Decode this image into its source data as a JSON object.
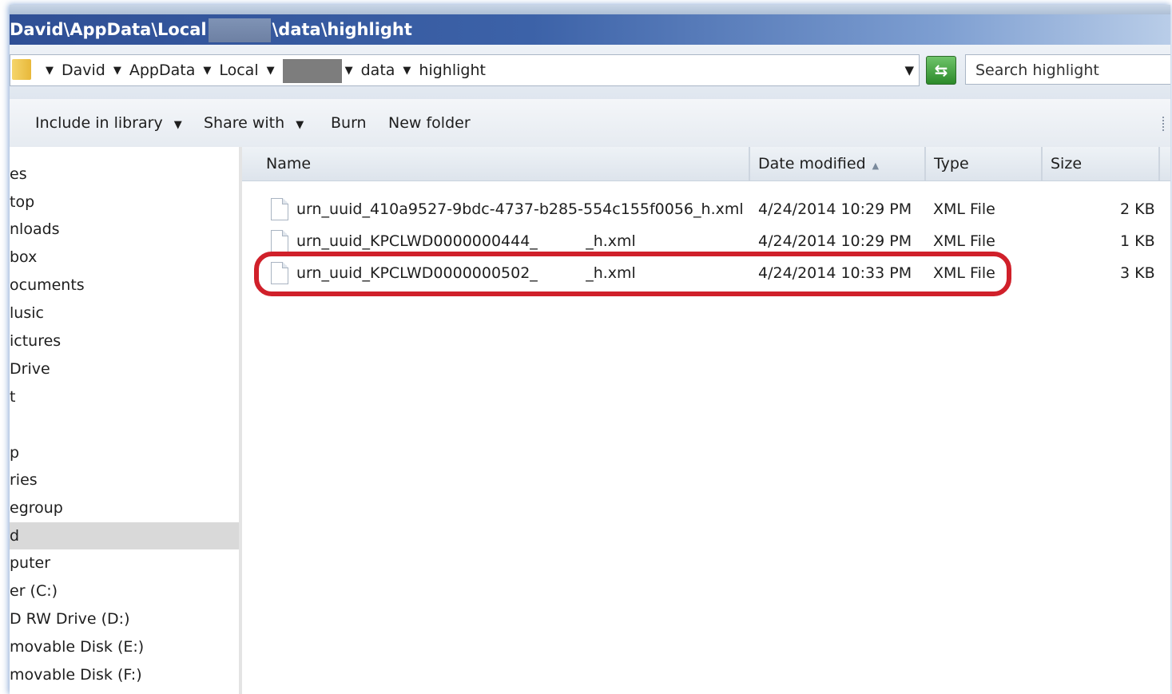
{
  "window": {
    "title_prefix": "David\\AppData\\Local",
    "title_suffix": "\\data\\highlight"
  },
  "address": {
    "crumbs": [
      "David",
      "AppData",
      "Local",
      "data",
      "highlight"
    ]
  },
  "search": {
    "placeholder": "Search highlight"
  },
  "toolbar": {
    "include_label": "Include in library",
    "share_label": "Share with",
    "burn_label": "Burn",
    "new_folder_label": "New folder"
  },
  "nav": {
    "items": [
      "es",
      "top",
      "nloads",
      "box",
      "ocuments",
      "lusic",
      "ictures",
      "Drive",
      "t",
      "",
      "p",
      "ries",
      "egroup",
      "d",
      "puter",
      "er (C:)",
      "D RW Drive (D:)",
      "movable Disk (E:)",
      "movable Disk (F:)"
    ],
    "selected_index": 13
  },
  "columns": {
    "name": "Name",
    "date": "Date modified",
    "type": "Type",
    "size": "Size"
  },
  "files": [
    {
      "name": "urn_uuid_410a9527-9bdc-4737-b285-554c155f0056_h.xml",
      "date": "4/24/2014 10:29 PM",
      "type": "XML File",
      "size": "2 KB"
    },
    {
      "name": "urn_uuid_KPCLWD0000000444_          _h.xml",
      "date": "4/24/2014 10:29 PM",
      "type": "XML File",
      "size": "1 KB"
    },
    {
      "name": "urn_uuid_KPCLWD0000000502_          _h.xml",
      "date": "4/24/2014 10:33 PM",
      "type": "XML File",
      "size": "3 KB"
    }
  ],
  "colors": {
    "highlight_ring": "#d0202a",
    "titlebar": "#2f4f95"
  }
}
